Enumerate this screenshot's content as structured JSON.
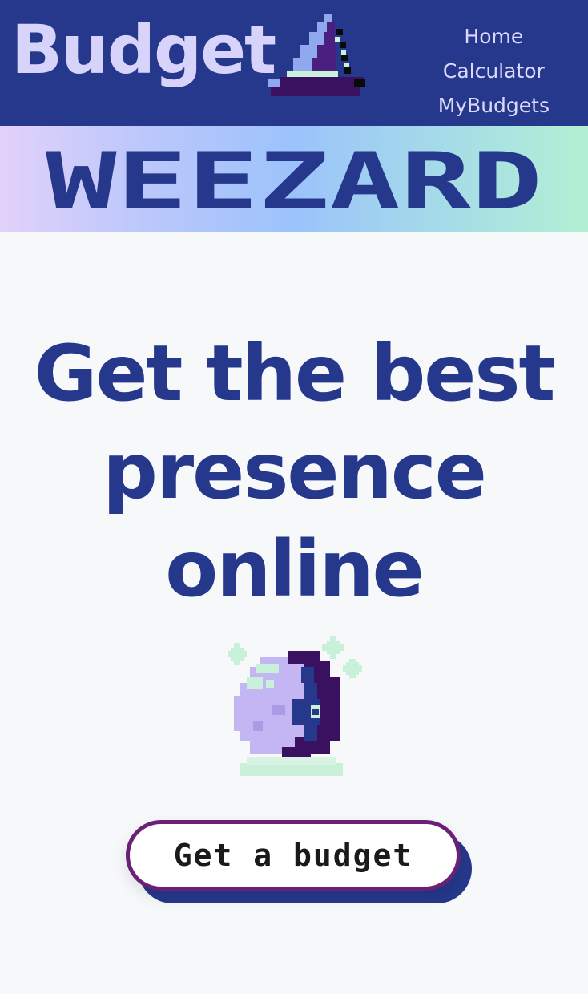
{
  "header": {
    "brand_text": "Budget",
    "logo_icon": "wizard-hat-icon",
    "nav": [
      {
        "label": "Home"
      },
      {
        "label": "Calculator"
      },
      {
        "label": "MyBudgets"
      }
    ]
  },
  "banner": {
    "wordmark": "WEEZARD"
  },
  "hero": {
    "headline_lines": [
      "Get the best",
      "presence",
      "online"
    ],
    "illustration_icon": "crystal-ball-icon",
    "cta_label": "Get a budget"
  },
  "colors": {
    "primary": "#25388b",
    "brand_text": "#d7d3fa",
    "cta_border": "#6a2076",
    "page_background": "#f7f8fa",
    "banner_gradient": [
      "#e2d2fb",
      "#9bc3fb",
      "#b2f0d4"
    ]
  }
}
